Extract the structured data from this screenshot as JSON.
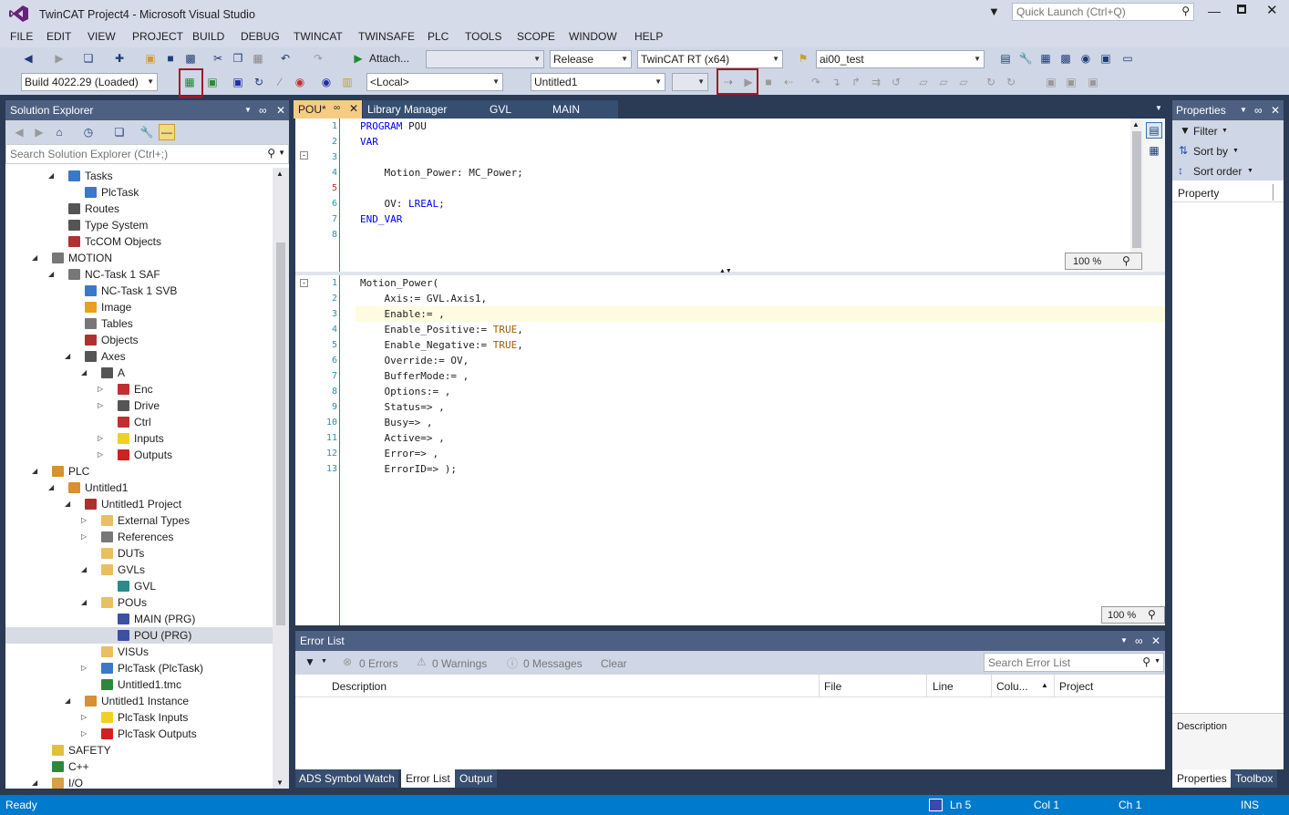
{
  "window": {
    "title": "TwinCAT Project4 - Microsoft Visual Studio",
    "quick_launch_placeholder": "Quick Launch (Ctrl+Q)"
  },
  "menu": [
    "FILE",
    "EDIT",
    "VIEW",
    "PROJECT",
    "BUILD",
    "DEBUG",
    "TWINCAT",
    "TWINSAFE",
    "PLC",
    "TOOLS",
    "SCOPE",
    "WINDOW",
    "HELP"
  ],
  "toolbar1": {
    "attach_label": "Attach...",
    "config": "Release",
    "platform": "TwinCAT RT (x64)",
    "target": "ai00_test"
  },
  "toolbar2": {
    "build": "Build 4022.29 (Loaded)",
    "local": "<Local>",
    "project": "Untitled1"
  },
  "solution_explorer": {
    "title": "Solution Explorer",
    "search_placeholder": "Search Solution Explorer (Ctrl+;)",
    "items": [
      {
        "label": "Tasks",
        "indent": 3,
        "exp": "open",
        "icon": "tasks"
      },
      {
        "label": "PlcTask",
        "indent": 4,
        "exp": "",
        "icon": "task"
      },
      {
        "label": "Routes",
        "indent": 3,
        "exp": "",
        "icon": "routes"
      },
      {
        "label": "Type System",
        "indent": 3,
        "exp": "",
        "icon": "types"
      },
      {
        "label": "TcCOM Objects",
        "indent": 3,
        "exp": "",
        "icon": "tccom"
      },
      {
        "label": "MOTION",
        "indent": 2,
        "exp": "open",
        "icon": "motion"
      },
      {
        "label": "NC-Task 1 SAF",
        "indent": 3,
        "exp": "open",
        "icon": "nctask"
      },
      {
        "label": "NC-Task 1 SVB",
        "indent": 4,
        "exp": "",
        "icon": "task"
      },
      {
        "label": "Image",
        "indent": 4,
        "exp": "",
        "icon": "image"
      },
      {
        "label": "Tables",
        "indent": 4,
        "exp": "",
        "icon": "tables"
      },
      {
        "label": "Objects",
        "indent": 4,
        "exp": "",
        "icon": "objects"
      },
      {
        "label": "Axes",
        "indent": 4,
        "exp": "open",
        "icon": "axes"
      },
      {
        "label": "A",
        "indent": 5,
        "exp": "open",
        "icon": "axis"
      },
      {
        "label": "Enc",
        "indent": 6,
        "exp": "closed",
        "icon": "enc"
      },
      {
        "label": "Drive",
        "indent": 6,
        "exp": "closed",
        "icon": "drive"
      },
      {
        "label": "Ctrl",
        "indent": 6,
        "exp": "",
        "icon": "ctrl"
      },
      {
        "label": "Inputs",
        "indent": 6,
        "exp": "closed",
        "icon": "inputs"
      },
      {
        "label": "Outputs",
        "indent": 6,
        "exp": "closed",
        "icon": "outputs"
      },
      {
        "label": "PLC",
        "indent": 2,
        "exp": "open",
        "icon": "plc"
      },
      {
        "label": "Untitled1",
        "indent": 3,
        "exp": "open",
        "icon": "plcproj"
      },
      {
        "label": "Untitled1 Project",
        "indent": 4,
        "exp": "open",
        "icon": "project"
      },
      {
        "label": "External Types",
        "indent": 5,
        "exp": "closed",
        "icon": "folder"
      },
      {
        "label": "References",
        "indent": 5,
        "exp": "closed",
        "icon": "refs"
      },
      {
        "label": "DUTs",
        "indent": 5,
        "exp": "",
        "icon": "folder"
      },
      {
        "label": "GVLs",
        "indent": 5,
        "exp": "open",
        "icon": "folder"
      },
      {
        "label": "GVL",
        "indent": 6,
        "exp": "",
        "icon": "gvl"
      },
      {
        "label": "POUs",
        "indent": 5,
        "exp": "open",
        "icon": "folder"
      },
      {
        "label": "MAIN (PRG)",
        "indent": 6,
        "exp": "",
        "icon": "pou"
      },
      {
        "label": "POU (PRG)",
        "indent": 6,
        "exp": "",
        "icon": "pou",
        "selected": true
      },
      {
        "label": "VISUs",
        "indent": 5,
        "exp": "",
        "icon": "folder"
      },
      {
        "label": "PlcTask (PlcTask)",
        "indent": 5,
        "exp": "closed",
        "icon": "task"
      },
      {
        "label": "Untitled1.tmc",
        "indent": 5,
        "exp": "",
        "icon": "tmc"
      },
      {
        "label": "Untitled1 Instance",
        "indent": 4,
        "exp": "open",
        "icon": "instance"
      },
      {
        "label": "PlcTask Inputs",
        "indent": 5,
        "exp": "closed",
        "icon": "inputs"
      },
      {
        "label": "PlcTask Outputs",
        "indent": 5,
        "exp": "closed",
        "icon": "outputs"
      },
      {
        "label": "SAFETY",
        "indent": 2,
        "exp": "",
        "icon": "safety"
      },
      {
        "label": "C++",
        "indent": 2,
        "exp": "",
        "icon": "cpp"
      },
      {
        "label": "I/O",
        "indent": 2,
        "exp": "open",
        "icon": "io"
      }
    ]
  },
  "editor": {
    "tabs": [
      {
        "label": "POU*",
        "active": true
      },
      {
        "label": "Library Manager"
      },
      {
        "label": "GVL"
      },
      {
        "label": "MAIN"
      }
    ],
    "decl_lines": [
      [
        {
          "t": "PROGRAM",
          "c": "kw"
        },
        {
          "t": " POU"
        }
      ],
      [
        {
          "t": "VAR",
          "c": "kw"
        }
      ],
      [
        {
          "t": ""
        }
      ],
      [
        {
          "t": "    Motion_Power: MC_Power;"
        }
      ],
      [
        {
          "t": ""
        }
      ],
      [
        {
          "t": "    OV: "
        },
        {
          "t": "LREAL",
          "c": "kw"
        },
        {
          "t": ";"
        }
      ],
      [
        {
          "t": "END_VAR",
          "c": "kw"
        }
      ],
      [
        {
          "t": ""
        }
      ]
    ],
    "impl_lines": [
      [
        {
          "t": "Motion_Power("
        }
      ],
      [
        {
          "t": "    Axis:= GVL.Axis1,"
        }
      ],
      [
        {
          "t": "    Enable:= ,"
        }
      ],
      [
        {
          "t": "    Enable_Positive:= "
        },
        {
          "t": "TRUE",
          "c": "tr"
        },
        {
          "t": ","
        }
      ],
      [
        {
          "t": "    Enable_Negative:= "
        },
        {
          "t": "TRUE",
          "c": "tr"
        },
        {
          "t": ","
        }
      ],
      [
        {
          "t": "    Override:= OV,"
        }
      ],
      [
        {
          "t": "    BufferMode:= ,"
        }
      ],
      [
        {
          "t": "    Options:= ,"
        }
      ],
      [
        {
          "t": "    Status=> ,"
        }
      ],
      [
        {
          "t": "    Busy=> ,"
        }
      ],
      [
        {
          "t": "    Active=> ,"
        }
      ],
      [
        {
          "t": "    Error=> ,"
        }
      ],
      [
        {
          "t": "    ErrorID=> );"
        }
      ]
    ],
    "zoom": "100 %"
  },
  "error_list": {
    "title": "Error List",
    "errors": "0 Errors",
    "warnings": "0 Warnings",
    "messages": "0 Messages",
    "clear": "Clear",
    "search_placeholder": "Search Error List",
    "columns": [
      "Description",
      "File",
      "Line",
      "Colu...",
      "Project"
    ]
  },
  "bottom_tabs": [
    "ADS Symbol Watch",
    "Error List",
    "Output"
  ],
  "properties": {
    "title": "Properties",
    "filter": "Filter",
    "sort_by": "Sort by",
    "sort_order": "Sort order",
    "col_property": "Property",
    "description": "Description",
    "tab_properties": "Properties",
    "tab_toolbox": "Toolbox"
  },
  "status": {
    "ready": "Ready",
    "ln": "Ln 5",
    "col": "Col 1",
    "ch": "Ch 1",
    "ins": "INS"
  }
}
